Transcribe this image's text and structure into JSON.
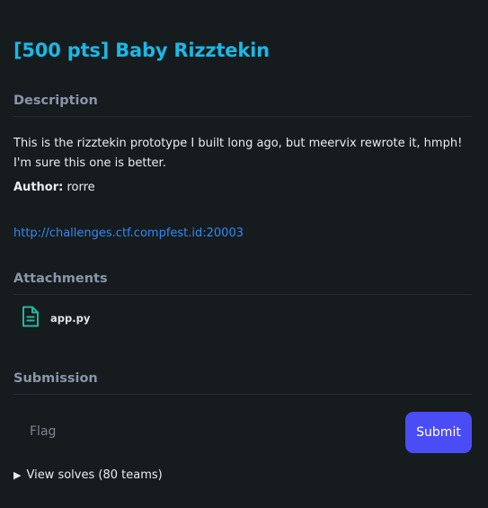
{
  "challenge": {
    "title": "[500 pts] Baby Rizztekin"
  },
  "description": {
    "heading": "Description",
    "text": "This is the rizztekin prototype I built long ago, but meervix rewrote it, hmph! I'm sure this one is better.",
    "author_label": "Author:",
    "author_name": "rorre",
    "link": "http://challenges.ctf.compfest.id:20003"
  },
  "attachments": {
    "heading": "Attachments",
    "files": [
      {
        "name": "app.py",
        "icon": "file-document-icon"
      }
    ]
  },
  "submission": {
    "heading": "Submission",
    "flag_placeholder": "Flag",
    "flag_value": "",
    "submit_label": "Submit",
    "solves_label": "View solves (80 teams)"
  },
  "colors": {
    "background": "#161b1e",
    "title": "#1bb8e4",
    "link": "#2f8af5",
    "submit": "#4a4df5",
    "file_icon": "#1fb99a"
  }
}
